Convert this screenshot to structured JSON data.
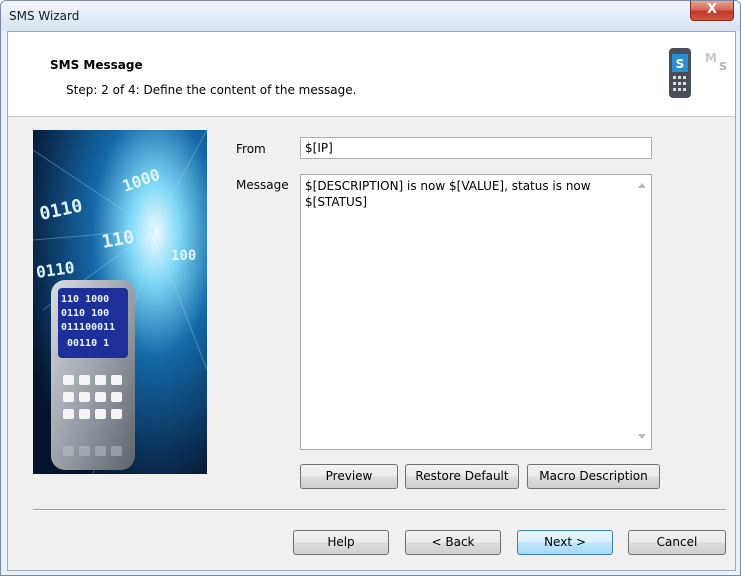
{
  "window": {
    "title": "SMS Wizard",
    "close_glyph": "X"
  },
  "header": {
    "title": "SMS Message",
    "subtitle": "Step: 2 of 4: Define the content of the message.",
    "logo_icon": "phone-sms-icon"
  },
  "side_image": {
    "icon": "binary-phone-illustration"
  },
  "form": {
    "from_label": "From",
    "from_value": "$[IP]",
    "message_label": "Message",
    "message_value": "$[DESCRIPTION] is now $[VALUE], status is now\n$[STATUS]"
  },
  "actions": {
    "preview": "Preview",
    "restore_default": "Restore Default",
    "macro_description": "Macro Description"
  },
  "footer": {
    "help": "Help",
    "back": "< Back",
    "next": "Next >",
    "cancel": "Cancel"
  },
  "colors": {
    "close_button": "#c0392b",
    "default_button_border": "#3c7fb1",
    "dialog_background": "#f0f0f0"
  }
}
